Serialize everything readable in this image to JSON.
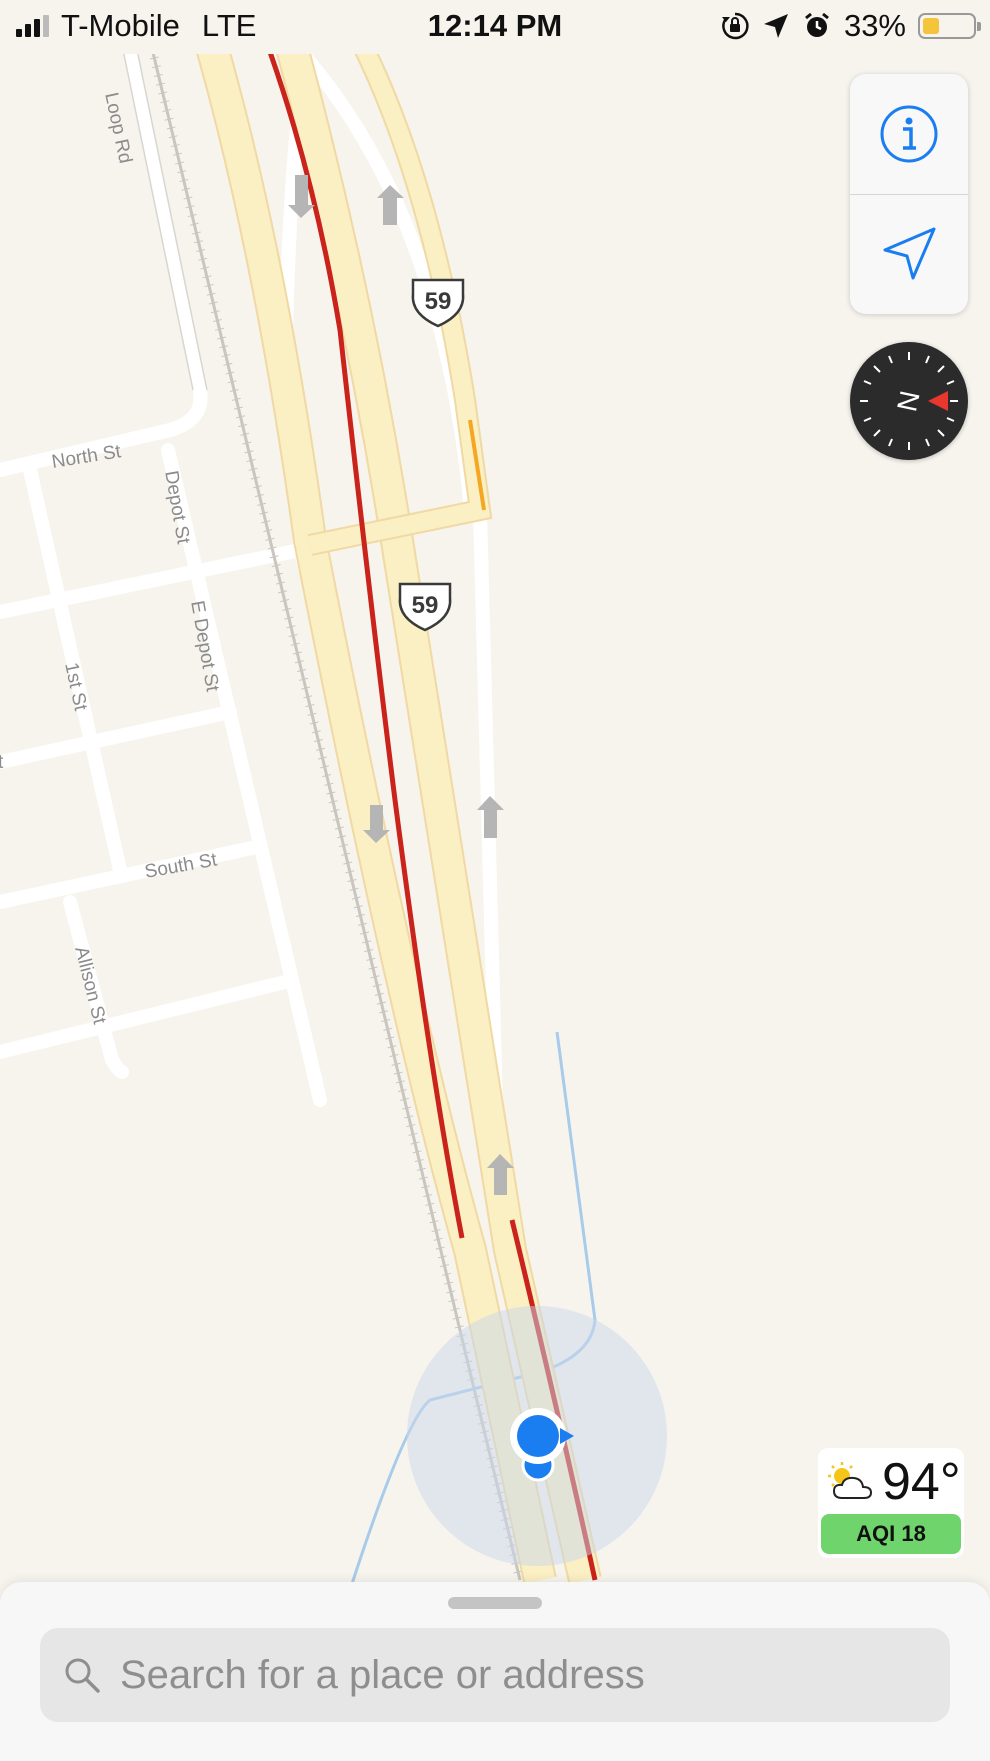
{
  "status_bar": {
    "carrier": "T-Mobile",
    "network": "LTE",
    "time": "12:14 PM",
    "battery_percent": "33%",
    "battery_level": 0.33,
    "signal_bars": 3
  },
  "map": {
    "highway_shields": [
      {
        "number": "59"
      },
      {
        "number": "59"
      }
    ],
    "streets": [
      {
        "name": "North St"
      },
      {
        "name": "Depot St"
      },
      {
        "name": "E Depot St"
      },
      {
        "name": "1st St"
      },
      {
        "name": "South St"
      },
      {
        "name": "Allison St"
      },
      {
        "name": "Loop Rd"
      },
      {
        "name": "t"
      }
    ]
  },
  "controls": {
    "info_icon": "info-icon",
    "location_icon": "location-arrow-icon",
    "compass_label": "N"
  },
  "weather": {
    "temperature": "94°",
    "condition_icon": "partly-cloudy-icon",
    "aqi_label": "AQI 18",
    "aqi_color": "#6fd46b"
  },
  "search": {
    "placeholder": "Search for a place or address"
  },
  "colors": {
    "accent": "#1a7df0",
    "traffic_heavy": "#c9231b",
    "highway": "#fbefc4"
  }
}
